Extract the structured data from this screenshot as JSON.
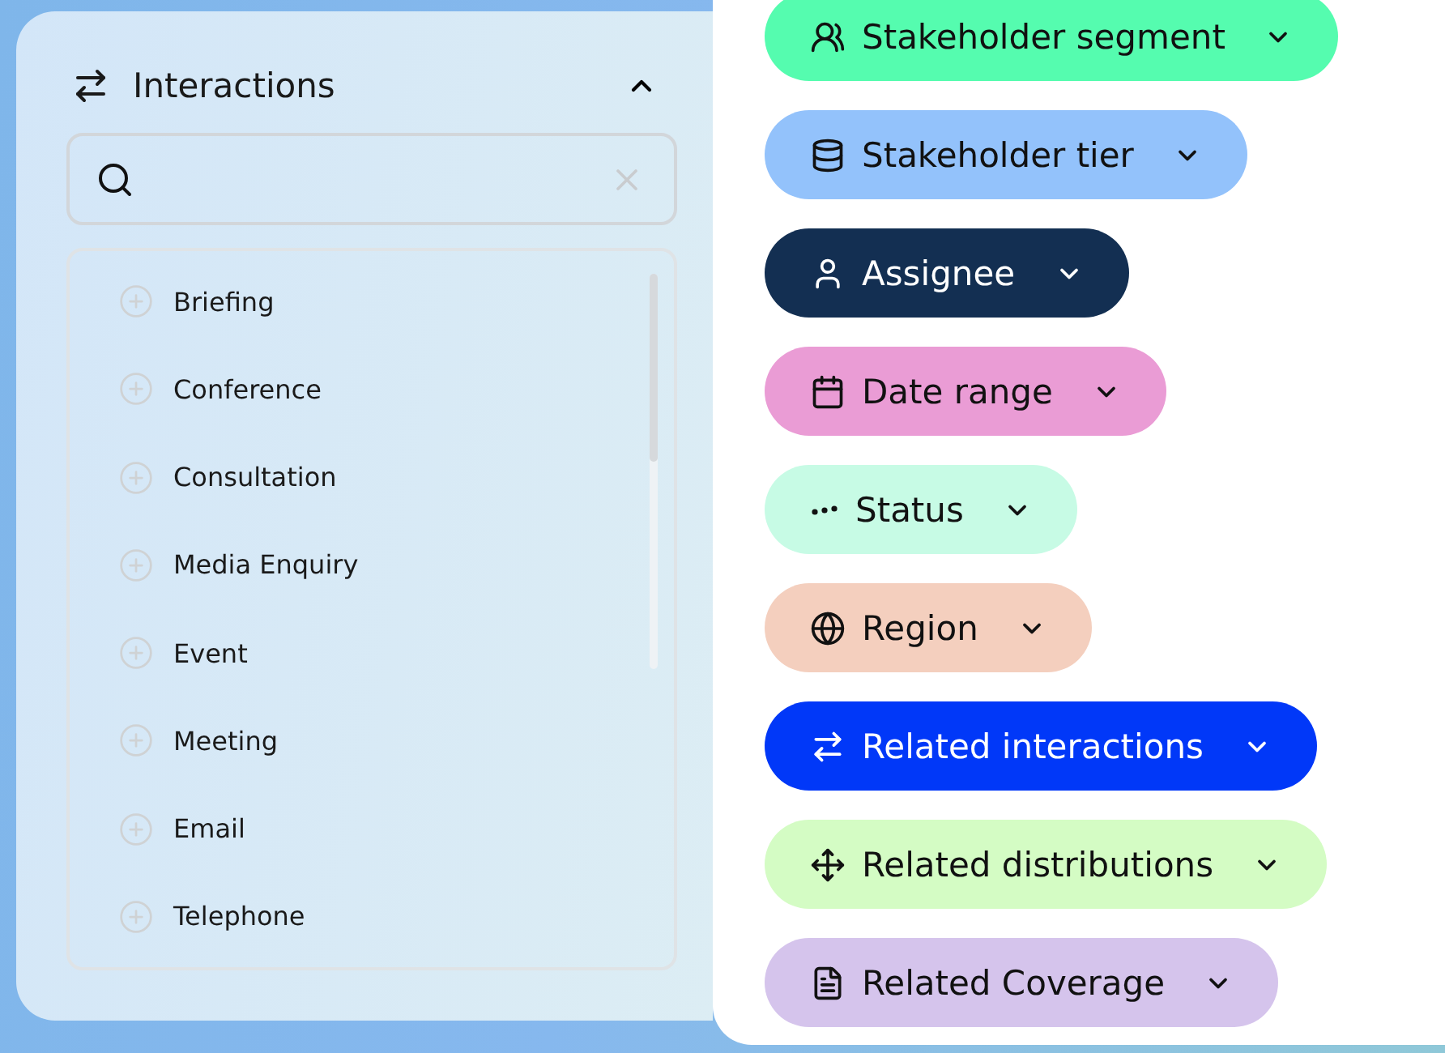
{
  "section": {
    "title": "Interactions",
    "expanded": true
  },
  "items": [
    {
      "label": "Briefing"
    },
    {
      "label": "Conference"
    },
    {
      "label": "Consultation"
    },
    {
      "label": "Media Enquiry"
    },
    {
      "label": "Event"
    },
    {
      "label": "Meeting"
    },
    {
      "label": "Email"
    },
    {
      "label": "Telephone"
    }
  ],
  "filters": [
    {
      "label": "Stakeholder segment",
      "color": "#55fcaf"
    },
    {
      "label": "Stakeholder tier",
      "color": "#93c2fb"
    },
    {
      "label": "Assignee",
      "color": "#132f52"
    },
    {
      "label": "Date range",
      "color": "#ea9cd5"
    },
    {
      "label": "Status",
      "color": "#c7fbe5"
    },
    {
      "label": "Region",
      "color": "#f4cfbe"
    },
    {
      "label": "Related interactions",
      "color": "#0138f8"
    },
    {
      "label": "Related distributions",
      "color": "#d4fcc4"
    },
    {
      "label": "Related Coverage",
      "color": "#d5c4ec"
    }
  ]
}
